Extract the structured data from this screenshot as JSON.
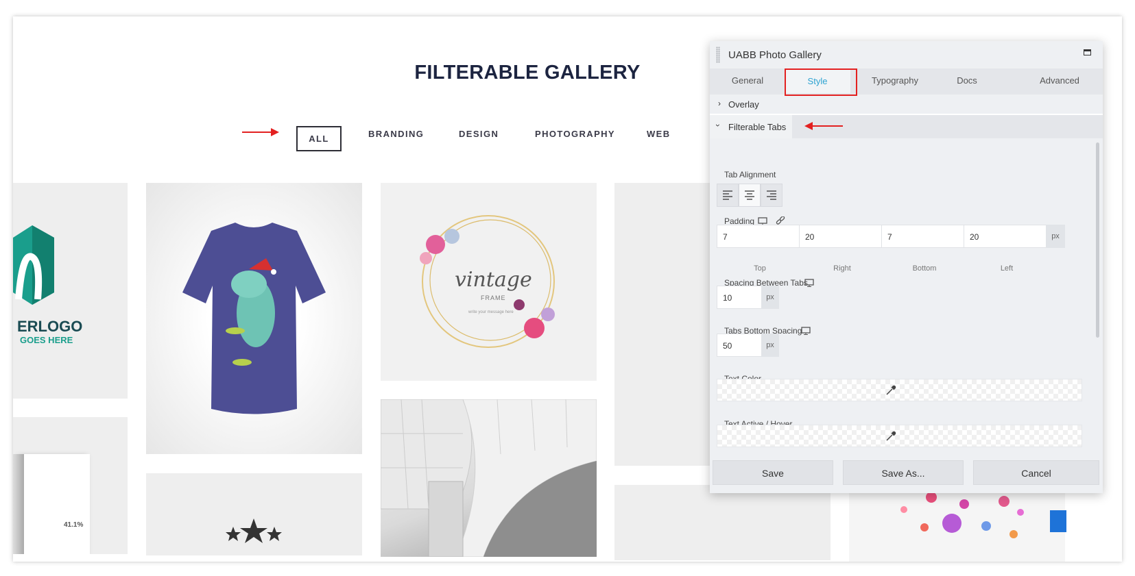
{
  "gallery": {
    "title": "FILTERABLE GALLERY",
    "filters": [
      "ALL",
      "BRANDING",
      "DESIGN",
      "PHOTOGRAPHY",
      "WEB"
    ],
    "active_filter": "ALL",
    "logo_text_1": "ERLOGO",
    "logo_text_2": "GOES HERE",
    "vintage_text": "vintage",
    "vintage_sub": "FRAME",
    "vintage_small": "write your message here",
    "brochure_stat": "41.1%"
  },
  "panel": {
    "title": "UABB Photo Gallery",
    "tabs": [
      "General",
      "Style",
      "Typography",
      "Docs",
      "Advanced"
    ],
    "active_tab": "Style",
    "section_overlay": "Overlay",
    "section_filterable": "Filterable Tabs",
    "tab_alignment_label": "Tab Alignment",
    "padding_label": "Padding",
    "padding": {
      "top": "7",
      "right": "20",
      "bottom": "7",
      "left": "20",
      "unit": "px"
    },
    "padding_sublabels": [
      "Top",
      "Right",
      "Bottom",
      "Left"
    ],
    "spacing_between_label": "Spacing Between Tabs",
    "spacing_between_value": "10",
    "bottom_spacing_label": "Tabs Bottom Spacing",
    "bottom_spacing_value": "50",
    "unit": "px",
    "text_color_label": "Text Color",
    "text_active_label": "Text Active / Hover",
    "buttons": {
      "save": "Save",
      "save_as": "Save As...",
      "cancel": "Cancel"
    }
  },
  "colors": {
    "accent": "#2ea3d1",
    "annotation_red": "#e32020",
    "title_dark": "#1c2440",
    "tshirt": "#4d4e94",
    "logo_teal": "#1a9e8c"
  }
}
